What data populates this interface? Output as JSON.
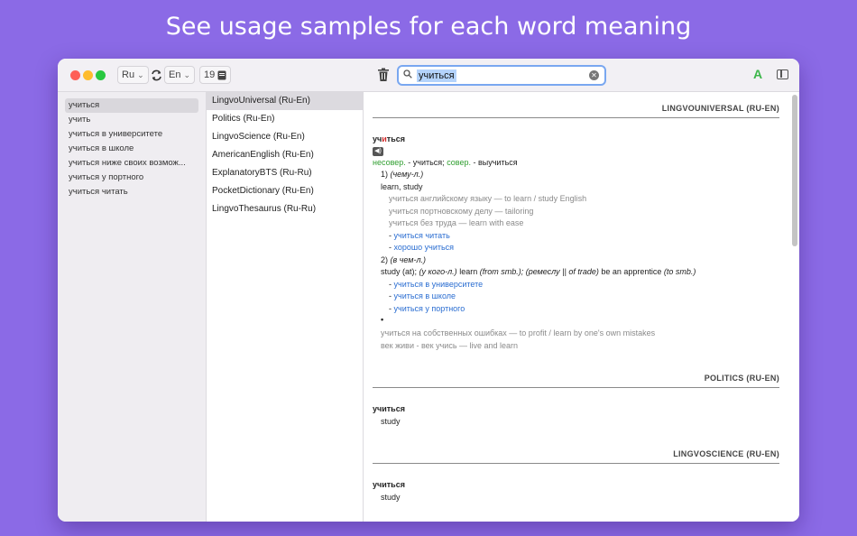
{
  "headline": "See usage samples for each word meaning",
  "toolbar": {
    "source_lang": "Ru",
    "target_lang": "En",
    "history_count": "19",
    "search_query": "учиться",
    "font_letter": "A"
  },
  "suggestions": [
    "учиться",
    "учить",
    "учиться в университете",
    "учиться в школе",
    "учиться ниже своих возмож...",
    "учиться у портного",
    "учиться читать"
  ],
  "dictionaries": [
    "LingvoUniversal (Ru-En)",
    "Politics (Ru-En)",
    "LingvoScience (Ru-En)",
    "AmericanEnglish (Ru-En)",
    "ExplanatoryBTS (Ru-Ru)",
    "PocketDictionary (Ru-En)",
    "LingvoThesaurus (Ru-Ru)"
  ],
  "article": {
    "s1_title": "LINGVOUNIVERSAL (RU-EN)",
    "s1_head_a": "уч",
    "s1_head_b": "и",
    "s1_head_c": "ться",
    "s1_aspect_imperf": "несовер.",
    "s1_aspect_mid": " - учиться; ",
    "s1_aspect_perf": "совер.",
    "s1_aspect_tail": " - выучиться",
    "m1_num": "1) ",
    "m1_gram": "(чему-л.)",
    "m1_trans": "learn, study",
    "m1_ex1": "учиться английскому языку — to learn / study English",
    "m1_ex2": "учиться портновскому делу — tailoring",
    "m1_ex3": "учиться без труда — learn with ease",
    "m1_link_prefix": "- ",
    "m1_link1": "учиться читать",
    "m1_link2": "хорошо учиться",
    "m2_num": "2) ",
    "m2_gram": "(в чем-л.)",
    "m2_t1": "study (at); ",
    "m2_t2": "(у кого-л.)",
    "m2_t3": " learn ",
    "m2_t4": "(from smb.); (ремеслу || of trade)",
    "m2_t5": " be an apprentice ",
    "m2_t6": "(to smb.)",
    "m2_link_prefix": "- ",
    "m2_link1": "учиться в университете",
    "m2_link2": "учиться в школе",
    "m2_link3": "учиться у портного",
    "bullet": "•",
    "idiom1": "учиться на собственных ошибках — to profit / learn by one's own mistakes",
    "idiom2": "век живи - век учись — live and learn",
    "s2_title": "POLITICS (RU-EN)",
    "s2_head": "учиться",
    "s2_trans": "study",
    "s3_title": "LINGVOSCIENCE (RU-EN)",
    "s3_head": "учиться",
    "s3_trans": "study",
    "speaker_icon": "speaker-icon"
  },
  "colors": {
    "background": "#8b6ae6",
    "link": "#2a6dd1",
    "aspect_green": "#2f9e2f",
    "stress_red": "#d02a2a",
    "search_focus": "#79a7f0"
  }
}
